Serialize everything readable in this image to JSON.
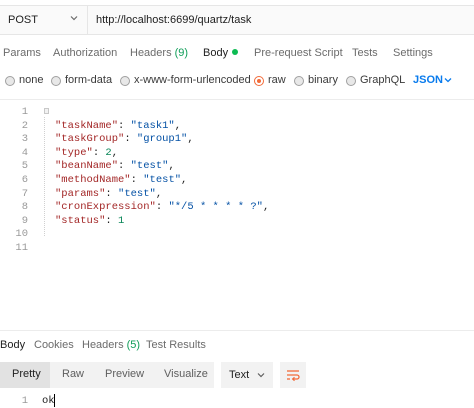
{
  "request": {
    "method": "POST",
    "url": "http://localhost:6699/quartz/task"
  },
  "request_tabs": {
    "params": "Params",
    "authorization": "Authorization",
    "headers": "Headers",
    "headers_count": "(9)",
    "body": "Body",
    "prerequest": "Pre-request Script",
    "tests": "Tests",
    "settings": "Settings"
  },
  "body_options": {
    "none": "none",
    "form_data": "form-data",
    "urlencoded": "x-www-form-urlencoded",
    "raw": "raw",
    "binary": "binary",
    "graphql": "GraphQL",
    "format": "JSON",
    "selected": "raw"
  },
  "editor": {
    "line_numbers": [
      "1",
      "2",
      "3",
      "4",
      "5",
      "6",
      "7",
      "8",
      "9",
      "10",
      "11"
    ],
    "lines": [
      {
        "open": "{"
      },
      {
        "key": "\"taskName\"",
        "value": "\"task1\"",
        "value_type": "str",
        "trail": ","
      },
      {
        "key": "\"taskGroup\"",
        "value": "\"group1\"",
        "value_type": "str",
        "trail": ","
      },
      {
        "key": "\"type\"",
        "value": "2",
        "value_type": "num",
        "trail": ","
      },
      {
        "key": "\"beanName\"",
        "value": "\"test\"",
        "value_type": "str",
        "trail": ","
      },
      {
        "key": "\"methodName\"",
        "value": "\"test\"",
        "value_type": "str",
        "trail": ","
      },
      {
        "key": "\"params\"",
        "value": "\"test\"",
        "value_type": "str",
        "trail": ","
      },
      {
        "key": "\"cronExpression\"",
        "value": "\"*/5 * * * * ?\"",
        "value_type": "str",
        "trail": ","
      },
      {
        "key": "\"status\"",
        "value": "1",
        "value_type": "num",
        "trail": ""
      },
      {
        "close": "}"
      },
      {}
    ]
  },
  "response_tabs": {
    "body": "Body",
    "cookies": "Cookies",
    "headers": "Headers",
    "headers_count": "(5)",
    "test_results": "Test Results"
  },
  "view_modes": {
    "pretty": "Pretty",
    "raw": "Raw",
    "preview": "Preview",
    "visualize": "Visualize",
    "type": "Text"
  },
  "response": {
    "line_number": "1",
    "text": "ok"
  },
  "colors": {
    "accent": "#f26b3a",
    "format_blue": "#097bed",
    "count_green": "#0f9d58"
  },
  "icons": {
    "method_dropdown": "chevron-down-icon",
    "format_dropdown": "chevron-down-icon",
    "type_dropdown": "chevron-down-icon",
    "wrap": "wrap-lines-icon"
  }
}
